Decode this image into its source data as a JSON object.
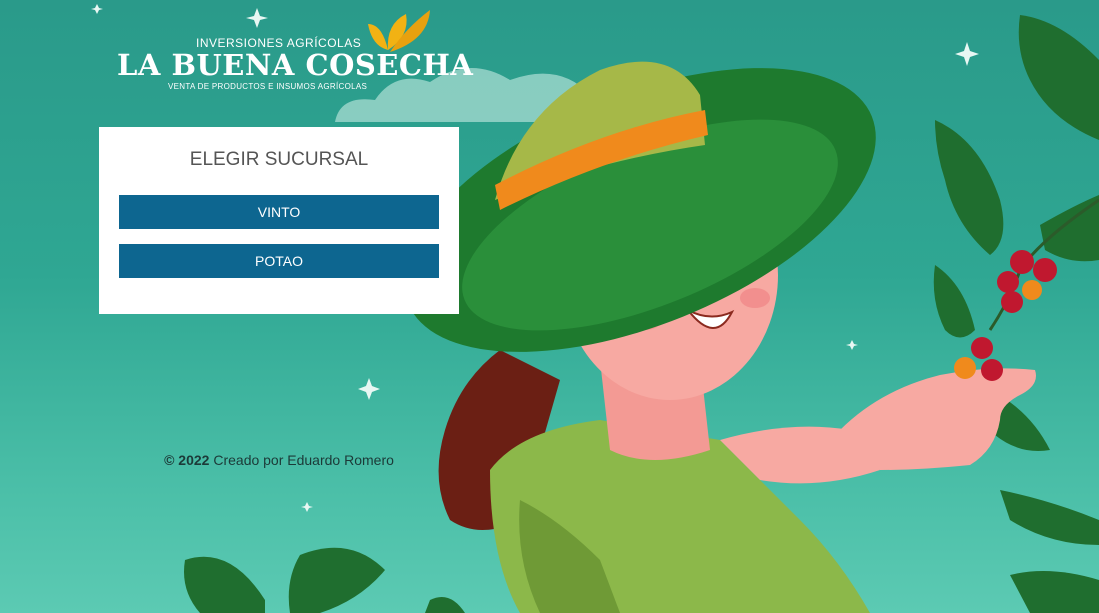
{
  "logo": {
    "top_text": "INVERSIONES AGRÍCOLAS",
    "main_text": "LA BUENA COSECHA",
    "sub_text": "VENTA DE PRODUCTOS E INSUMOS AGRÍCOLAS"
  },
  "branch_select": {
    "title": "ELEGIR SUCURSAL",
    "options": [
      "VINTO",
      "POTAO"
    ]
  },
  "footer": {
    "copyright_year": "© 2022",
    "credit": " Creado por Eduardo Romero"
  },
  "colors": {
    "background": "#2fa793",
    "button": "#0d6690",
    "hat_green": "#1e7a2e",
    "skin": "#f7a9a2",
    "coffee_cherry": "#c0182f"
  },
  "icons": [
    "sparkle-icon",
    "leaf-icon"
  ]
}
